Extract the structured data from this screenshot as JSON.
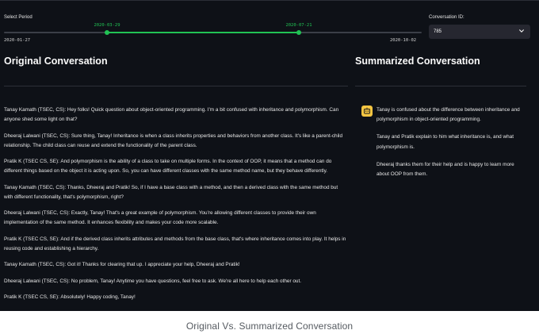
{
  "slider": {
    "label": "Select Period",
    "min_label": "2020-01-27",
    "max_label": "2020-10-02",
    "selected_start": "2020-03-29",
    "selected_end": "2020-07-21",
    "accent_color": "#21c354"
  },
  "select": {
    "label": "Conversation ID:",
    "value": "785",
    "icon": "chevron-down-icon"
  },
  "original": {
    "title": "Original Conversation",
    "messages": [
      "Tanay Kamath (TSEC, CS): Hey folks! Quick question about object-oriented programming. I'm a bit confused with inheritance and polymorphism. Can anyone shed some light on that?",
      "Dheeraj Lalwani (TSEC, CS): Sure thing, Tanay! Inheritance is when a class inherits properties and behaviors from another class. It's like a parent-child relationship. The child class can reuse and extend the functionality of the parent class.",
      "Pratik K (TSEC CS, SE): And polymorphism is the ability of a class to take on multiple forms. In the context of OOP, it means that a method can do different things based on the object it is acting upon. So, you can have different classes with the same method name, but they behave differently.",
      "Tanay Kamath (TSEC, CS): Thanks, Dheeraj and Pratik! So, if I have a base class with a method, and then a derived class with the same method but with different functionality, that's polymorphism, right?",
      "Dheeraj Lalwani (TSEC, CS): Exactly, Tanay! That's a great example of polymorphism. You're allowing different classes to provide their own implementation of the same method. It enhances flexibility and makes your code more scalable.",
      "Pratik K (TSEC CS, SE): And if the derived class inherits attributes and methods from the base class, that's where inheritance comes into play. It helps in reusing code and establishing a hierarchy.",
      "Tanay Kamath (TSEC, CS): Got it! Thanks for clearing that up. I appreciate your help, Dheeraj and Pratik!",
      "Dheeraj Lalwani (TSEC, CS): No problem, Tanay! Anytime you have questions, feel free to ask. We're all here to help each other out.",
      "Pratik K (TSEC CS, SE): Absolutely! Happy coding, Tanay!"
    ]
  },
  "summarized": {
    "title": "Summarized Conversation",
    "avatar_icon": "assistant-avatar-icon",
    "avatar_color": "#f4c542",
    "paragraphs": [
      "Tanay is confused about the difference between inheritance and polymorphism in object-oriented programming.",
      "Tanay and Pratik explain to him what inheritance is, and what polymorphism is.",
      "Dheeraj thanks them for their help and is happy to learn more about OOP from them."
    ]
  },
  "caption": "Original Vs. Summarized Conversation"
}
